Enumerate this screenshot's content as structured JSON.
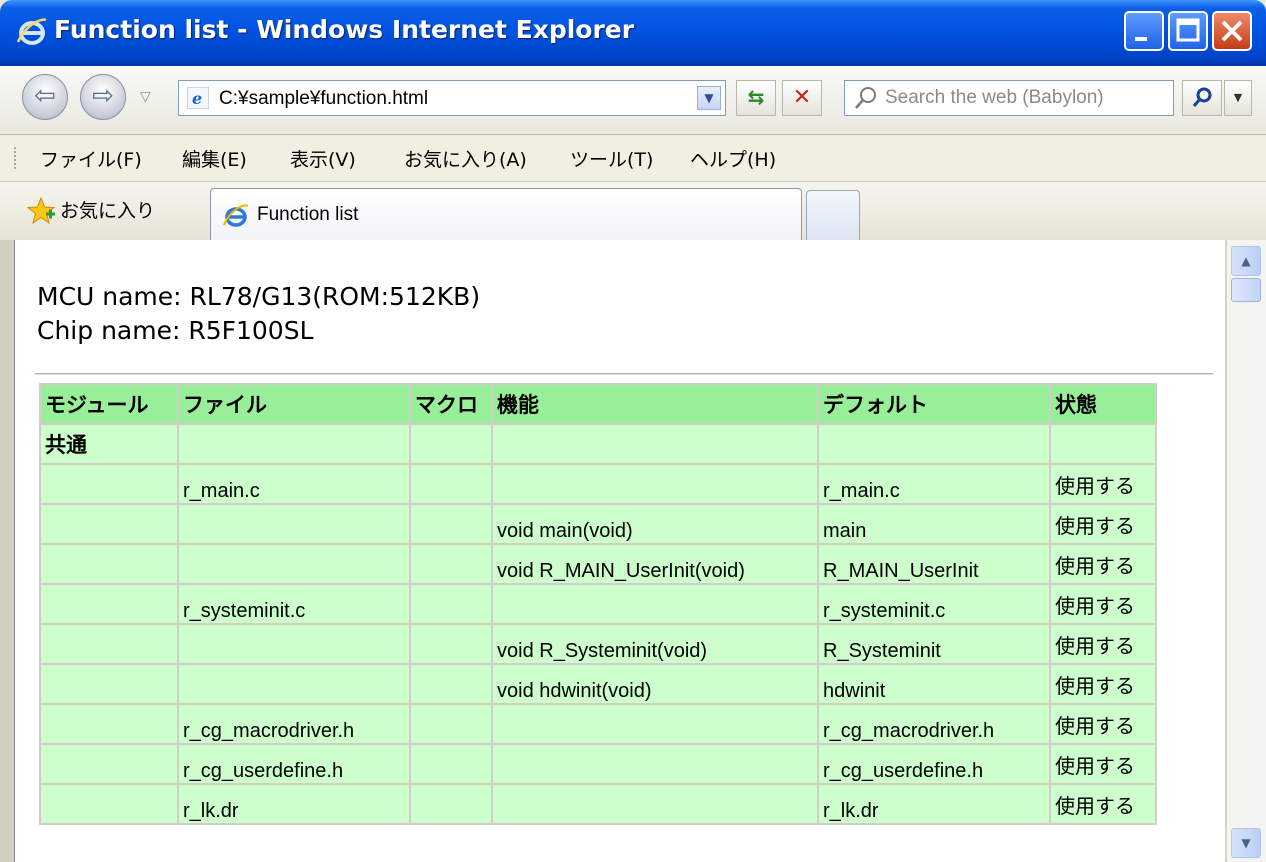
{
  "window": {
    "title": "Function list - Windows Internet Explorer"
  },
  "address_bar": {
    "url": "C:¥sample¥function.html",
    "search_placeholder": "Search the web (Babylon)"
  },
  "menu": {
    "items": [
      "ファイル(F)",
      "編集(E)",
      "表示(V)",
      "お気に入り(A)",
      "ツール(T)",
      "ヘルプ(H)"
    ]
  },
  "favorites": {
    "label": "お気に入り"
  },
  "tab": {
    "title": "Function list"
  },
  "page": {
    "mcu_line": "MCU name: RL78/G13(ROM:512KB)",
    "chip_line": "Chip name: R5F100SL"
  },
  "table": {
    "headers": [
      "モジュール",
      "ファイル",
      "マクロ",
      "機能",
      "デフォルト",
      "状態"
    ],
    "rows": [
      [
        "共通",
        "",
        "",
        "",
        "",
        ""
      ],
      [
        "",
        "r_main.c",
        "",
        "",
        "r_main.c",
        "使用する"
      ],
      [
        "",
        "",
        "",
        "void main(void)",
        "main",
        "使用する"
      ],
      [
        "",
        "",
        "",
        "void R_MAIN_UserInit(void)",
        "R_MAIN_UserInit",
        "使用する"
      ],
      [
        "",
        "r_systeminit.c",
        "",
        "",
        "r_systeminit.c",
        "使用する"
      ],
      [
        "",
        "",
        "",
        "void R_Systeminit(void)",
        "R_Systeminit",
        "使用する"
      ],
      [
        "",
        "",
        "",
        "void hdwinit(void)",
        "hdwinit",
        "使用する"
      ],
      [
        "",
        "r_cg_macrodriver.h",
        "",
        "",
        "r_cg_macrodriver.h",
        "使用する"
      ],
      [
        "",
        "r_cg_userdefine.h",
        "",
        "",
        "r_cg_userdefine.h",
        "使用する"
      ],
      [
        "",
        "r_lk.dr",
        "",
        "",
        "r_lk.dr",
        "使用する"
      ]
    ]
  },
  "icons": {
    "ie": "ie-logo-icon",
    "back": "back-arrow-icon",
    "forward": "forward-arrow-icon",
    "refresh": "refresh-icon",
    "stop": "stop-icon",
    "search": "search-icon",
    "favorites": "star-icon"
  }
}
